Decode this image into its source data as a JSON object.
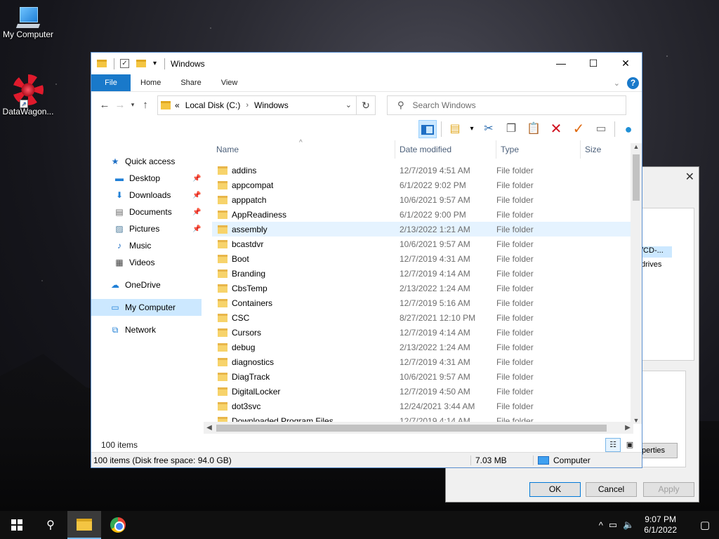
{
  "desktop": {
    "icons": [
      {
        "label": "My Computer"
      },
      {
        "label": "DataWagon..."
      }
    ]
  },
  "background_dialog": {
    "list_selected": "/CD-...",
    "list_text": "drives",
    "properties_button": "perties",
    "ok": "OK",
    "cancel": "Cancel",
    "apply": "Apply"
  },
  "explorer": {
    "title": "Windows",
    "ribbon_tabs": [
      "File",
      "Home",
      "Share",
      "View"
    ],
    "address": {
      "prefix": "«",
      "crumbs": [
        "Local Disk (C:)",
        "Windows"
      ]
    },
    "search_placeholder": "Search Windows",
    "nav": {
      "quick_access": "Quick access",
      "pinned": [
        "Desktop",
        "Downloads",
        "Documents",
        "Pictures"
      ],
      "unpinned": [
        "Music",
        "Videos"
      ],
      "onedrive": "OneDrive",
      "my_computer": "My Computer",
      "network": "Network"
    },
    "columns": [
      "Name",
      "Date modified",
      "Type",
      "Size"
    ],
    "files": [
      {
        "name": "addins",
        "date": "12/7/2019 4:51 AM",
        "type": "File folder"
      },
      {
        "name": "appcompat",
        "date": "6/1/2022 9:02 PM",
        "type": "File folder"
      },
      {
        "name": "apppatch",
        "date": "10/6/2021 9:57 AM",
        "type": "File folder"
      },
      {
        "name": "AppReadiness",
        "date": "6/1/2022 9:00 PM",
        "type": "File folder"
      },
      {
        "name": "assembly",
        "date": "2/13/2022 1:21 AM",
        "type": "File folder"
      },
      {
        "name": "bcastdvr",
        "date": "10/6/2021 9:57 AM",
        "type": "File folder"
      },
      {
        "name": "Boot",
        "date": "12/7/2019 4:31 AM",
        "type": "File folder"
      },
      {
        "name": "Branding",
        "date": "12/7/2019 4:14 AM",
        "type": "File folder"
      },
      {
        "name": "CbsTemp",
        "date": "2/13/2022 1:24 AM",
        "type": "File folder"
      },
      {
        "name": "Containers",
        "date": "12/7/2019 5:16 AM",
        "type": "File folder"
      },
      {
        "name": "CSC",
        "date": "8/27/2021 12:10 PM",
        "type": "File folder"
      },
      {
        "name": "Cursors",
        "date": "12/7/2019 4:14 AM",
        "type": "File folder"
      },
      {
        "name": "debug",
        "date": "2/13/2022 1:24 AM",
        "type": "File folder"
      },
      {
        "name": "diagnostics",
        "date": "12/7/2019 4:31 AM",
        "type": "File folder"
      },
      {
        "name": "DiagTrack",
        "date": "10/6/2021 9:57 AM",
        "type": "File folder"
      },
      {
        "name": "DigitalLocker",
        "date": "12/7/2019 4:50 AM",
        "type": "File folder"
      },
      {
        "name": "dot3svc",
        "date": "12/24/2021 3:44 AM",
        "type": "File folder"
      },
      {
        "name": "Downloaded Program Files",
        "date": "12/7/2019 4:14 AM",
        "type": "File folder"
      }
    ],
    "status_count": "100 items",
    "details": {
      "summary": "100 items (Disk free space: 94.0 GB)",
      "size": "7.03 MB",
      "location": "Computer"
    }
  },
  "taskbar": {
    "time": "9:07 PM",
    "date": "6/1/2022"
  }
}
